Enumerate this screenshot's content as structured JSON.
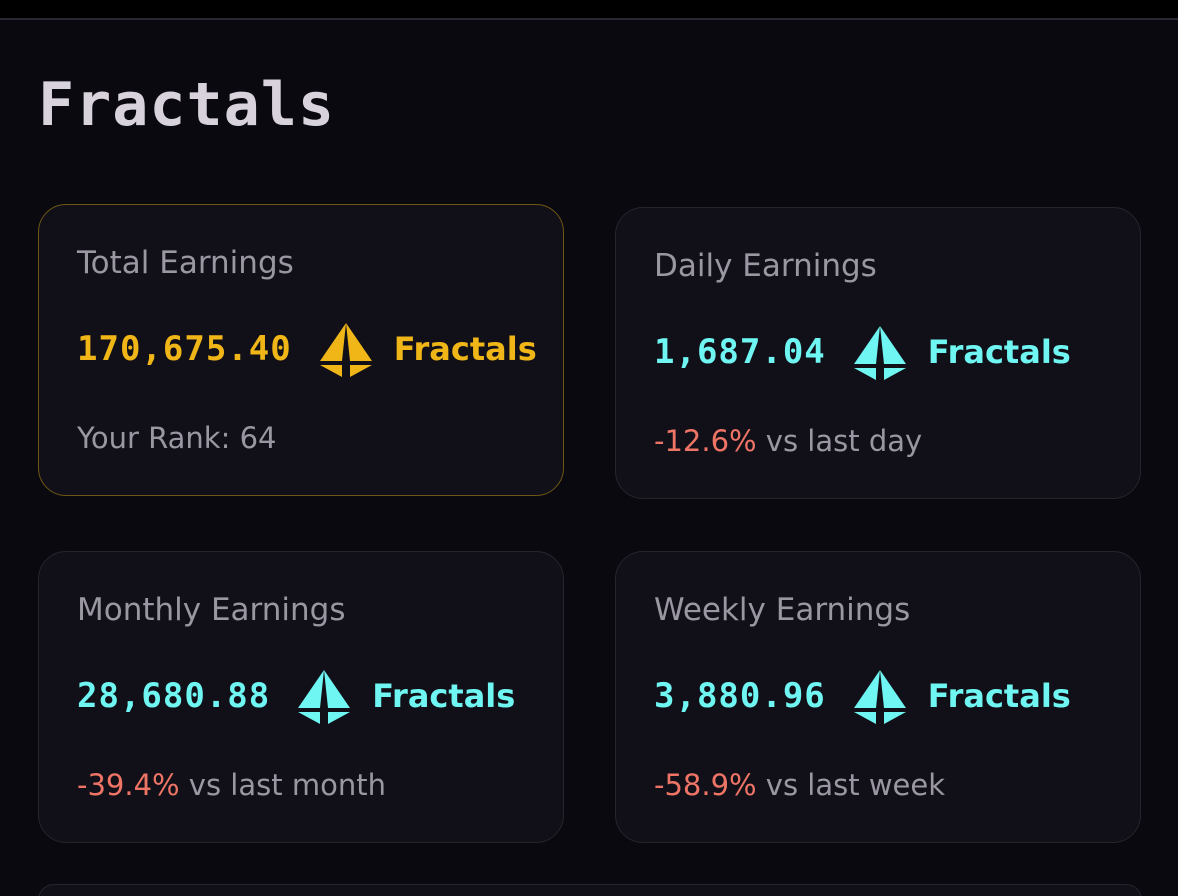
{
  "page": {
    "title": "Fractals"
  },
  "colors": {
    "background": "#0a0910",
    "card": "#111018",
    "gold_accent": "#f0b617",
    "cyan_accent": "#6ff6f2",
    "negative": "#ee7466",
    "label": "#9a96a2"
  },
  "cards": {
    "total": {
      "label": "Total Earnings",
      "amount": "170,675.40",
      "unit": "Fractals",
      "icon": "fractals-token-icon",
      "footer": "Your Rank: 64"
    },
    "daily": {
      "label": "Daily Earnings",
      "amount": "1,687.04",
      "unit": "Fractals",
      "icon": "fractals-token-icon",
      "change": "-12.6%",
      "comparison": " vs last day"
    },
    "monthly": {
      "label": "Monthly Earnings",
      "amount": "28,680.88",
      "unit": "Fractals",
      "icon": "fractals-token-icon",
      "change": "-39.4%",
      "comparison": " vs last month"
    },
    "weekly": {
      "label": "Weekly Earnings",
      "amount": "3,880.96",
      "unit": "Fractals",
      "icon": "fractals-token-icon",
      "change": "-58.9%",
      "comparison": " vs last week"
    }
  }
}
